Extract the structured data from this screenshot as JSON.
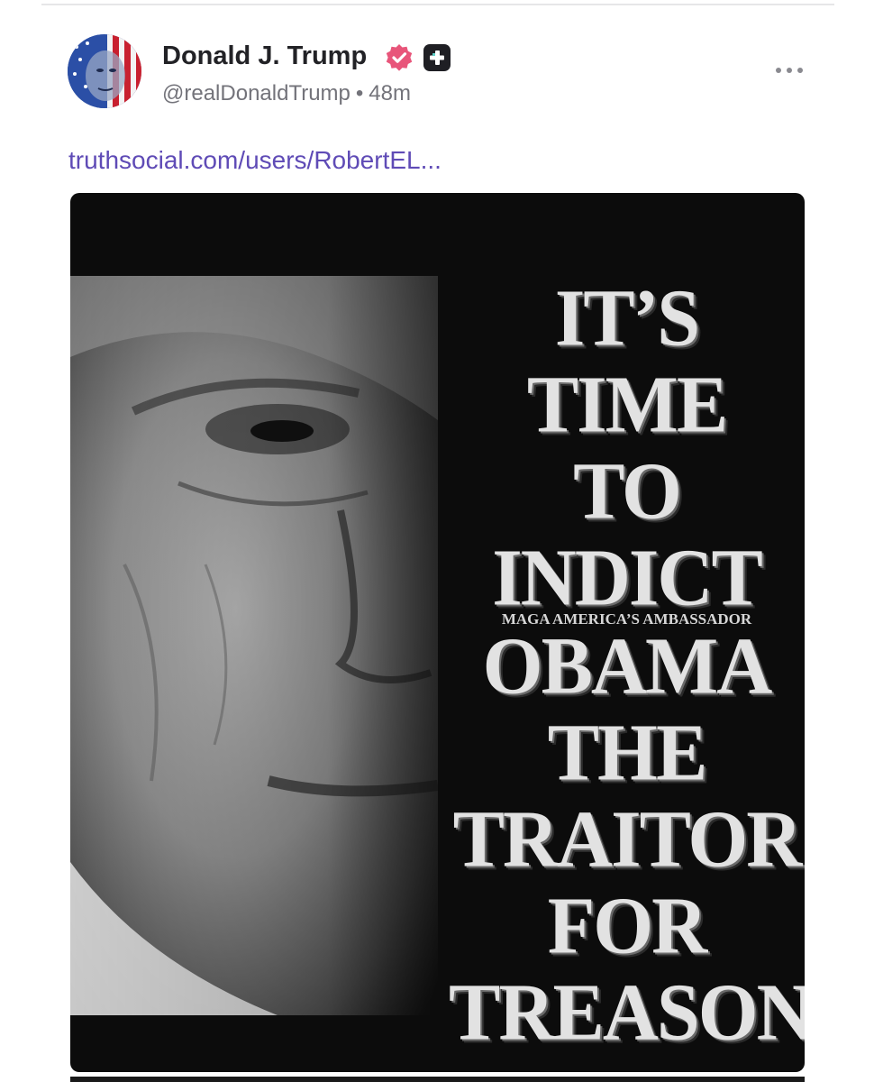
{
  "post": {
    "author": {
      "display_name": "Donald J. Trump",
      "handle": "@realDonaldTrump",
      "timestamp": "48m",
      "separator": "•",
      "badges": [
        "verified-icon",
        "plus-badge-icon"
      ]
    },
    "link_text": "truthsocial.com/users/RobertEL...",
    "poster": {
      "lines": [
        "IT’S",
        "TIME",
        "TO",
        "INDICT",
        "OBAMA",
        "THE",
        "TRAITOR",
        "FOR",
        "TREASON"
      ],
      "subtitle": "MAGA AMERICA’S AMBASSADOR"
    }
  },
  "colors": {
    "verified": "#e8557a",
    "link": "#5f4bb6",
    "meta": "#73737a",
    "poster_bg": "#0c0c0c"
  }
}
